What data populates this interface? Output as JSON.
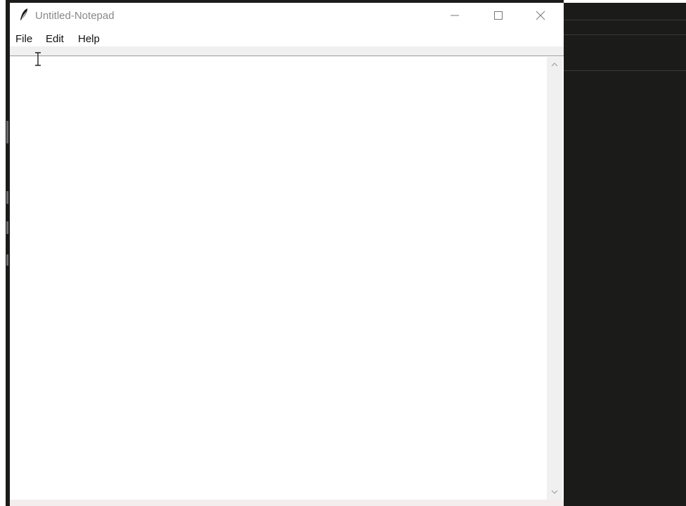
{
  "window": {
    "title": "Untitled-Notepad",
    "app_icon": "feather-icon"
  },
  "window_controls": {
    "minimize_icon": "minimize-icon",
    "maximize_icon": "maximize-icon",
    "close_icon": "close-icon"
  },
  "menubar": {
    "items": [
      {
        "label": "File"
      },
      {
        "label": "Edit"
      },
      {
        "label": "Help"
      }
    ]
  },
  "editor": {
    "content": ""
  },
  "scrollbar": {
    "up_icon": "chevron-up-icon",
    "down_icon": "chevron-down-icon"
  },
  "colors": {
    "window_bg": "#ffffff",
    "menu_strip": "#f0f0f0",
    "background_app": "#1b1c1a",
    "title_text": "#888888"
  }
}
